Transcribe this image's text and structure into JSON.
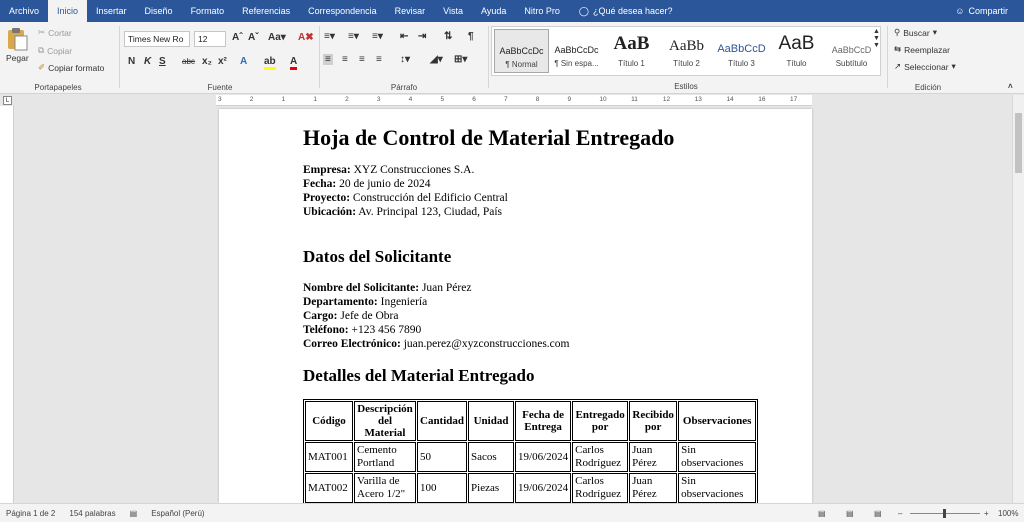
{
  "menu": {
    "tabs": [
      "Archivo",
      "Inicio",
      "Insertar",
      "Diseño",
      "Formato",
      "Referencias",
      "Correspondencia",
      "Revisar",
      "Vista",
      "Ayuda",
      "Nitro Pro"
    ],
    "active_tab": "Inicio",
    "tell_me": "¿Qué desea hacer?",
    "share": "Compartir"
  },
  "ribbon": {
    "clipboard": {
      "paste": "Pegar",
      "cut": "Cortar",
      "copy": "Copiar",
      "format_painter": "Copiar formato",
      "label": "Portapapeles"
    },
    "font": {
      "family": "Times New Ro",
      "size": "12",
      "label": "Fuente"
    },
    "paragraph": {
      "label": "Párrafo"
    },
    "styles": {
      "label": "Estilos",
      "items": [
        {
          "preview": "AaBbCcDc",
          "name": "¶ Normal"
        },
        {
          "preview": "AaBbCcDc",
          "name": "¶ Sin espa..."
        },
        {
          "preview": "AaB",
          "name": "Título 1"
        },
        {
          "preview": "AaBb",
          "name": "Título 2"
        },
        {
          "preview": "AaBbCcD",
          "name": "Título 3"
        },
        {
          "preview": "AaB",
          "name": "Título"
        },
        {
          "preview": "AaBbCcD",
          "name": "Subtítulo"
        }
      ]
    },
    "editing": {
      "find": "Buscar",
      "replace": "Reemplazar",
      "select": "Seleccionar",
      "label": "Edición"
    }
  },
  "ruler": {
    "ticks": [
      "3",
      "2",
      "1",
      "1",
      "2",
      "3",
      "4",
      "5",
      "6",
      "7",
      "8",
      "9",
      "10",
      "11",
      "12",
      "13",
      "14",
      "16",
      "17"
    ]
  },
  "document": {
    "title": "Hoja de Control de Material Entregado",
    "info": [
      {
        "label": "Empresa:",
        "value": "XYZ Construcciones S.A."
      },
      {
        "label": "Fecha:",
        "value": "20 de junio de 2024"
      },
      {
        "label": "Proyecto:",
        "value": "Construcción del Edificio Central"
      },
      {
        "label": "Ubicación:",
        "value": "Av. Principal 123, Ciudad, País"
      }
    ],
    "section1": "Datos del Solicitante",
    "requester": [
      {
        "label": "Nombre del Solicitante:",
        "value": "Juan Pérez"
      },
      {
        "label": "Departamento:",
        "value": "Ingeniería"
      },
      {
        "label": "Cargo:",
        "value": "Jefe de Obra"
      },
      {
        "label": "Teléfono:",
        "value": "+123 456 7890"
      },
      {
        "label": "Correo Electrónico:",
        "value": "juan.perez@xyzconstrucciones.com"
      }
    ],
    "section2": "Detalles del Material Entregado",
    "table": {
      "headers": [
        "Código",
        "Descripción del Material",
        "Cantidad",
        "Unidad",
        "Fecha de Entrega",
        "Entregado por",
        "Recibido por",
        "Observaciones"
      ],
      "rows": [
        [
          "MAT001",
          "Cemento Portland",
          "50",
          "Sacos",
          "19/06/2024",
          "Carlos Rodríguez",
          "Juan Pérez",
          "Sin observaciones"
        ],
        [
          "MAT002",
          "Varilla de Acero 1/2\"",
          "100",
          "Piezas",
          "19/06/2024",
          "Carlos Rodríguez",
          "Juan Pérez",
          "Sin observaciones"
        ]
      ]
    }
  },
  "status": {
    "page": "Página 1 de 2",
    "words": "154 palabras",
    "language": "Español (Perú)",
    "zoom": "100%"
  }
}
